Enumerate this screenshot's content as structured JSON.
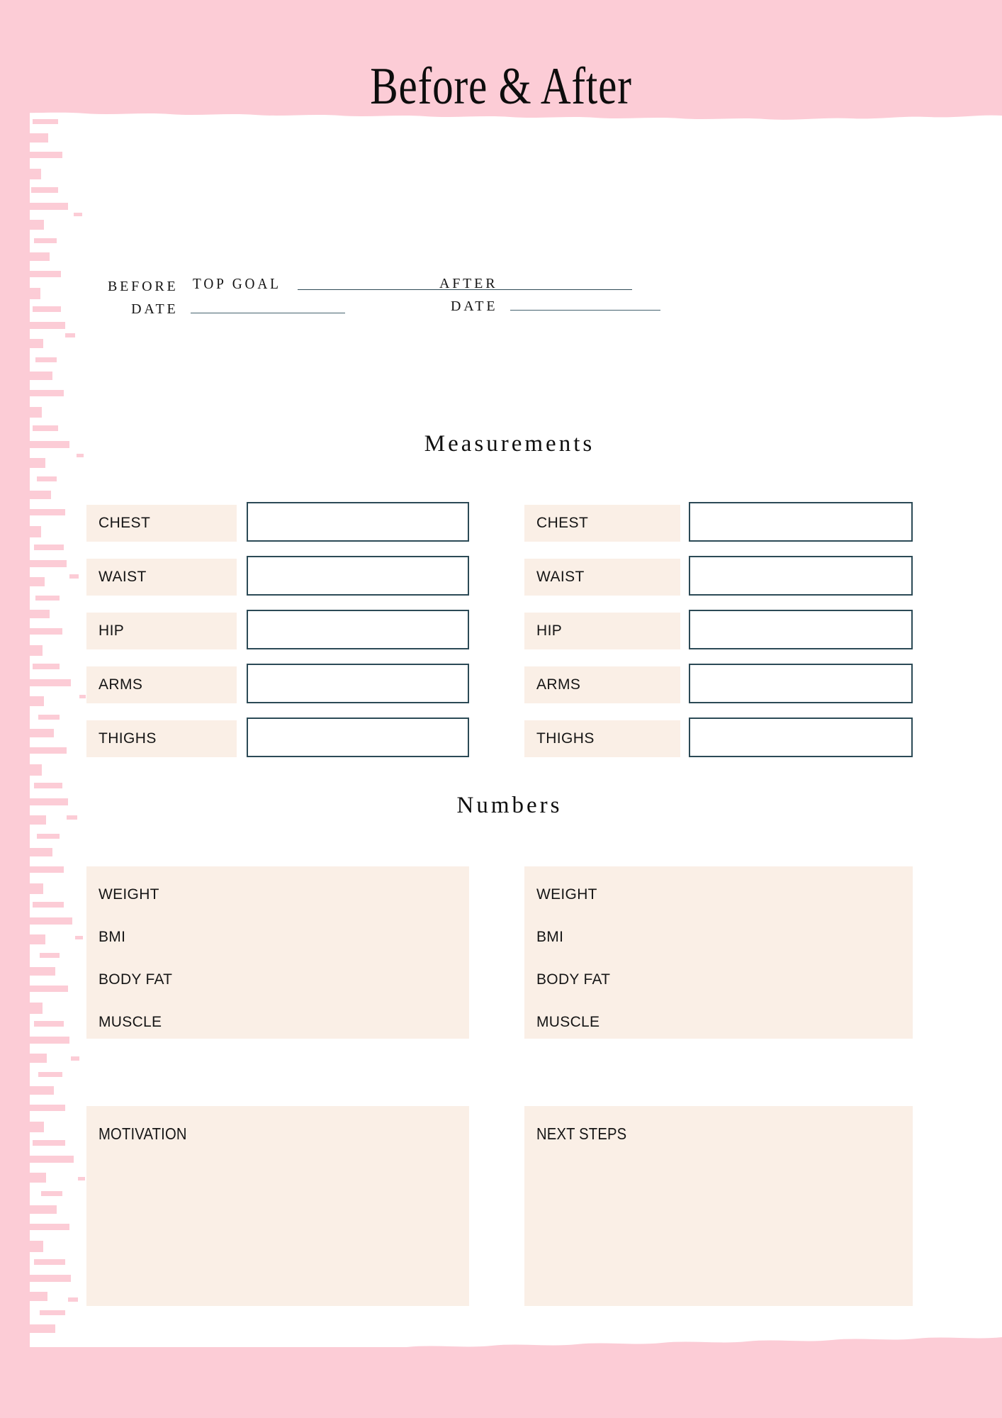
{
  "document": {
    "title": "Before & After",
    "theme": {
      "brush_pink": "#FCCCD6",
      "label_cream": "#FAEFE6",
      "input_border_teal": "#2C4A56",
      "rule_line": "#2F4B56",
      "text_dark": "#131313",
      "page_background": "#FFFFFF"
    }
  },
  "top_goal": {
    "label": "TOP GOAL",
    "value": "",
    "placeholder": ""
  },
  "dates": {
    "before": {
      "label_line1": "BEFORE",
      "label_line2": "DATE",
      "value": "",
      "placeholder": ""
    },
    "after": {
      "label_line1": "AFTER",
      "label_line2": "DATE",
      "value": "",
      "placeholder": ""
    }
  },
  "measurements": {
    "heading": "Measurements",
    "rows": [
      "CHEST",
      "WAIST",
      "HIP",
      "ARMS",
      "THIGHS"
    ],
    "before": [
      {
        "label": "CHEST",
        "value": ""
      },
      {
        "label": "WAIST",
        "value": ""
      },
      {
        "label": "HIP",
        "value": ""
      },
      {
        "label": "ARMS",
        "value": ""
      },
      {
        "label": "THIGHS",
        "value": ""
      }
    ],
    "after": [
      {
        "label": "CHEST",
        "value": ""
      },
      {
        "label": "WAIST",
        "value": ""
      },
      {
        "label": "HIP",
        "value": ""
      },
      {
        "label": "ARMS",
        "value": ""
      },
      {
        "label": "THIGHS",
        "value": ""
      }
    ]
  },
  "numbers": {
    "heading": "Numbers",
    "before": [
      {
        "label": "WEIGHT",
        "value": ""
      },
      {
        "label": "BMI",
        "value": ""
      },
      {
        "label": "BODY FAT",
        "value": ""
      },
      {
        "label": "MUSCLE",
        "value": ""
      }
    ],
    "after": [
      {
        "label": "WEIGHT",
        "value": ""
      },
      {
        "label": "BMI",
        "value": ""
      },
      {
        "label": "BODY FAT",
        "value": ""
      },
      {
        "label": "MUSCLE",
        "value": ""
      }
    ]
  },
  "notes": {
    "motivation": {
      "title": "MOTIVATION",
      "value": ""
    },
    "next_steps": {
      "title": "NEXT STEPS",
      "value": ""
    }
  }
}
